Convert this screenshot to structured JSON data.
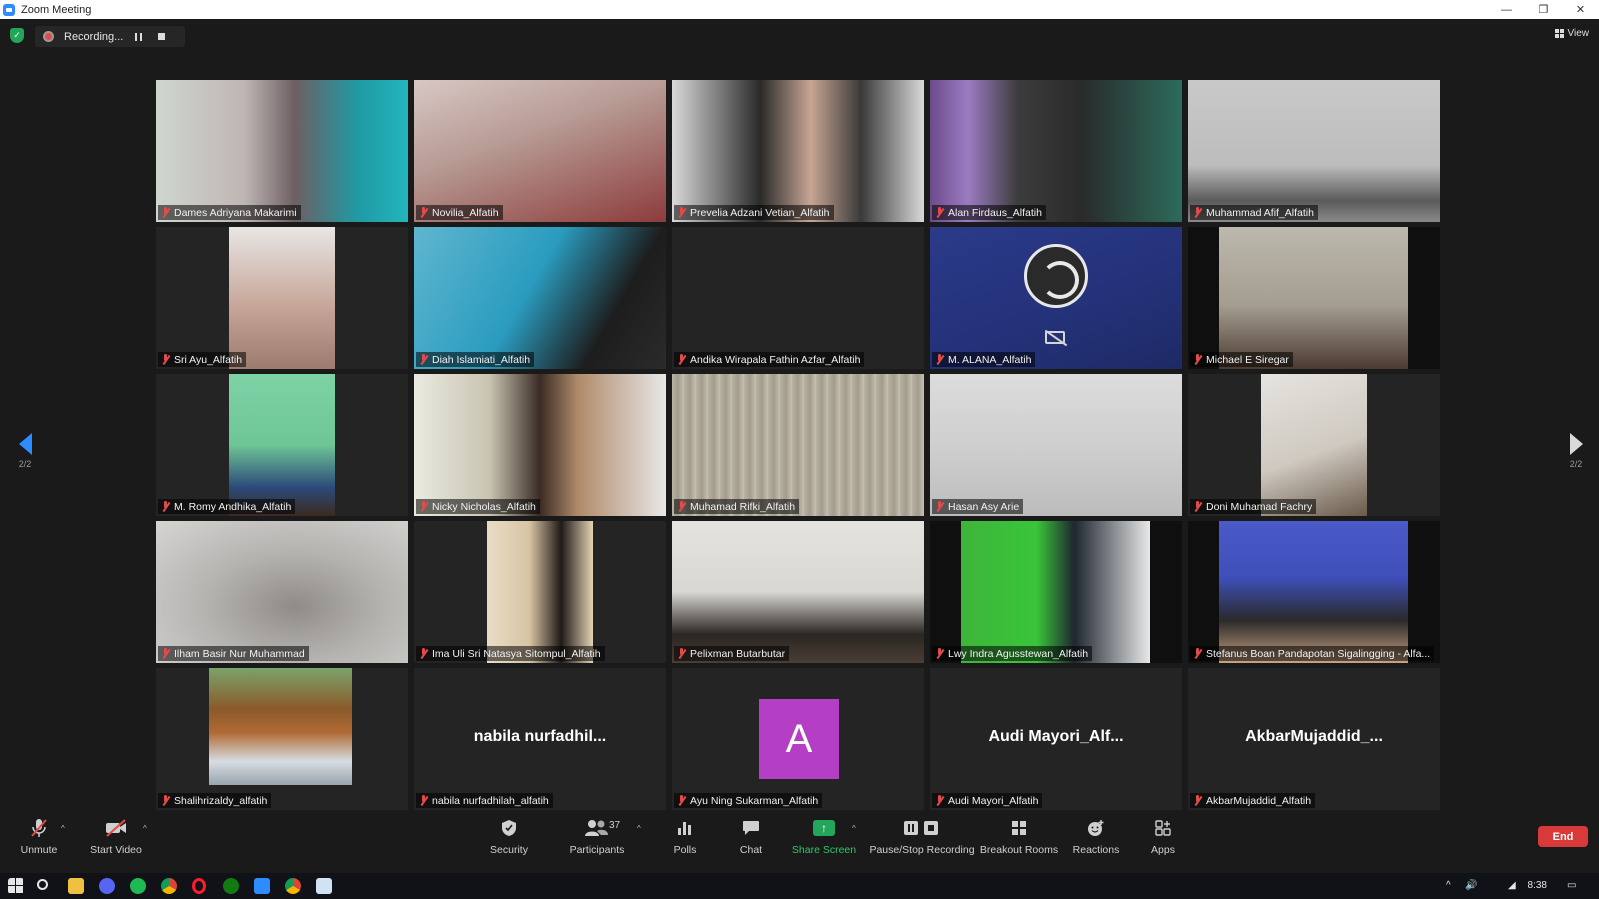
{
  "window": {
    "title": "Zoom Meeting",
    "minimize": "—",
    "restore": "❐",
    "close": "✕"
  },
  "topbar": {
    "recording_label": "Recording...",
    "view_label": "View"
  },
  "pagination": {
    "left": "2/2",
    "right": "2/2"
  },
  "participants": [
    {
      "name": "Dames Adriyana Makarimi"
    },
    {
      "name": "Novilia_Alfatih"
    },
    {
      "name": "Prevelia Adzani Vetian_Alfatih"
    },
    {
      "name": "Alan Firdaus_Alfatih"
    },
    {
      "name": "Muhammad Afif_Alfatih"
    },
    {
      "name": "Sri Ayu_Alfatih"
    },
    {
      "name": "Diah Islamiati_Alfatih"
    },
    {
      "name": "Andika Wirapala Fathin Azfar_Alfatih"
    },
    {
      "name": "M. ALANA_Alfatih"
    },
    {
      "name": "Michael E Siregar"
    },
    {
      "name": "M. Romy Andhika_Alfatih"
    },
    {
      "name": "Nicky Nicholas_Alfatih"
    },
    {
      "name": "Muhamad Rifki_Alfatih"
    },
    {
      "name": "Hasan Asy Arie"
    },
    {
      "name": "Doni Muhamad Fachry"
    },
    {
      "name": "Ilham Basir Nur Muhammad"
    },
    {
      "name": "Ima Uli Sri Natasya Sitompul_Alfatih"
    },
    {
      "name": "Pelixman Butarbutar"
    },
    {
      "name": "Lwy Indra Agusstewan_Alfatih"
    },
    {
      "name": "Stefanus Boan Pandapotan Sigalingging - Alfa..."
    },
    {
      "name": "Shalihrizaldy_alfatih"
    },
    {
      "name": "nabila nurfadhilah_alfatih",
      "display": "nabila  nurfadhil..."
    },
    {
      "name": "Ayu Ning Sukarman_Alfatih",
      "avatar": "A"
    },
    {
      "name": "Audi Mayori_Alfatih",
      "display": "Audi  Mayori_Alf..."
    },
    {
      "name": "AkbarMujaddid_Alfatih",
      "display": "AkbarMujaddid_..."
    }
  ],
  "toolbar": {
    "unmute": "Unmute",
    "start_video": "Start Video",
    "security": "Security",
    "participants": "Participants",
    "participants_count": "37",
    "polls": "Polls",
    "chat": "Chat",
    "share_screen": "Share Screen",
    "pause_stop_recording": "Pause/Stop Recording",
    "breakout_rooms": "Breakout Rooms",
    "reactions": "Reactions",
    "apps": "Apps",
    "end": "End"
  },
  "taskbar": {
    "time": "8:38"
  },
  "colors": {
    "accent": "#2d8cff",
    "end": "#d83a3a",
    "share": "#23a55a",
    "muted": "#e34b4b"
  }
}
